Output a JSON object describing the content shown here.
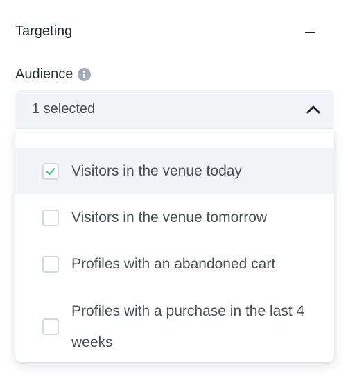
{
  "section": {
    "title": "Targeting"
  },
  "audience": {
    "label": "Audience",
    "selected_text": "1 selected",
    "options": [
      {
        "label": "Visitors in the venue today",
        "checked": true
      },
      {
        "label": "Visitors in the venue tomorrow",
        "checked": false
      },
      {
        "label": "Profiles with an abandoned cart",
        "checked": false
      },
      {
        "label": "Profiles with a purchase in the last 4 weeks",
        "checked": false
      }
    ]
  },
  "colors": {
    "check_accent": "#3cba6b",
    "field_bg": "#f2f4f7",
    "info_icon": "#a4acb7"
  },
  "icons": {
    "collapse": "minus-icon",
    "info": "info-icon",
    "chevron": "chevron-up-icon",
    "check": "checkmark-icon"
  }
}
